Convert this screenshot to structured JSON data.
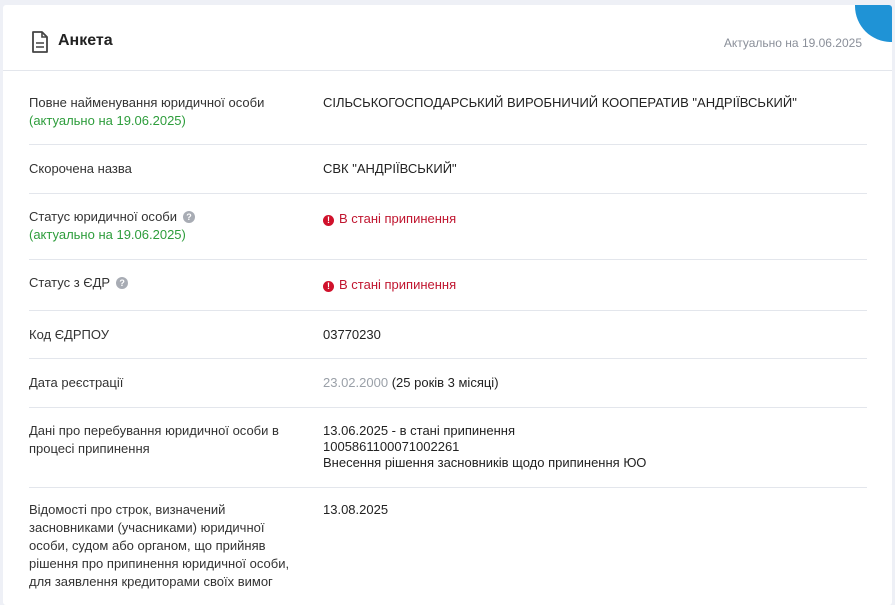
{
  "header": {
    "title": "Анкета",
    "updated": "Актуально на 19.06.2025",
    "doc_icon": "document-icon",
    "corner_icon": "graduation-cap-icon"
  },
  "colors": {
    "accent": "#1f93d6",
    "status_red": "#c0152f",
    "note_green": "#2e9d3c"
  },
  "rows": {
    "full_name": {
      "label": "Повне найменування юридичної особи",
      "note": "(актуально на 19.06.2025)",
      "value": "СІЛЬСЬКОГОСПОДАРСЬКИЙ ВИРОБНИЧИЙ КООПЕРАТИВ \"АНДРІЇВСЬКИЙ\""
    },
    "short_name": {
      "label": "Скорочена назва",
      "value": "СВК \"АНДРІЇВСЬКИЙ\""
    },
    "legal_status": {
      "label": "Статус юридичної особи",
      "note": "(актуально на 19.06.2025)",
      "value": "В стані припинення"
    },
    "edr_status": {
      "label": "Статус з ЄДР",
      "value": "В стані припинення"
    },
    "edrpou": {
      "label": "Код ЄДРПОУ",
      "value": "03770230"
    },
    "reg_date": {
      "label": "Дата реєстрації",
      "date": "23.02.2000",
      "age": "(25 років 3 місяці)"
    },
    "termination": {
      "label": "Дані про перебування юридичної особи в процесі припинення",
      "line1": "13.06.2025 - в стані припинення",
      "line2": "1005861100071002261",
      "line3": "Внесення рішення засновників щодо припинення ЮО"
    },
    "deadline": {
      "label": "Відомості про строк, визначений засновниками (учасниками) юридичної особи, судом або органом, що прийняв рішення про припинення юридичної особи, для заявлення кредиторами своїх вимог",
      "value": "13.08.2025"
    }
  }
}
